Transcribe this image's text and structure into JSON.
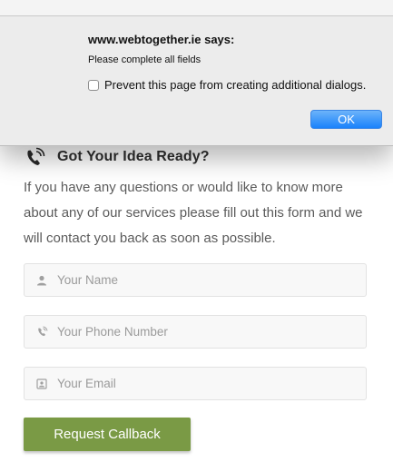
{
  "dialog": {
    "origin": "www.webtogether.ie says:",
    "message": "Please complete all fields",
    "prevent_label": "Prevent this page from creating additional dialogs.",
    "prevent_checked": false,
    "ok_label": "OK"
  },
  "contact": {
    "heading": "Got Your Idea Ready?",
    "intro": "If you have any questions or would like to know more about any of our services please fill out this form and we will contact you back as soon as possible.",
    "fields": {
      "name": {
        "placeholder": "Your Name",
        "value": "",
        "icon": "person-icon"
      },
      "phone": {
        "placeholder": "Your Phone Number",
        "value": "",
        "icon": "phone-icon"
      },
      "email": {
        "placeholder": "Your Email",
        "value": "",
        "icon": "email-icon"
      }
    },
    "submit_label": "Request Callback"
  },
  "colors": {
    "accent": "#7a9a45",
    "ok_button": "#1a82fb"
  }
}
